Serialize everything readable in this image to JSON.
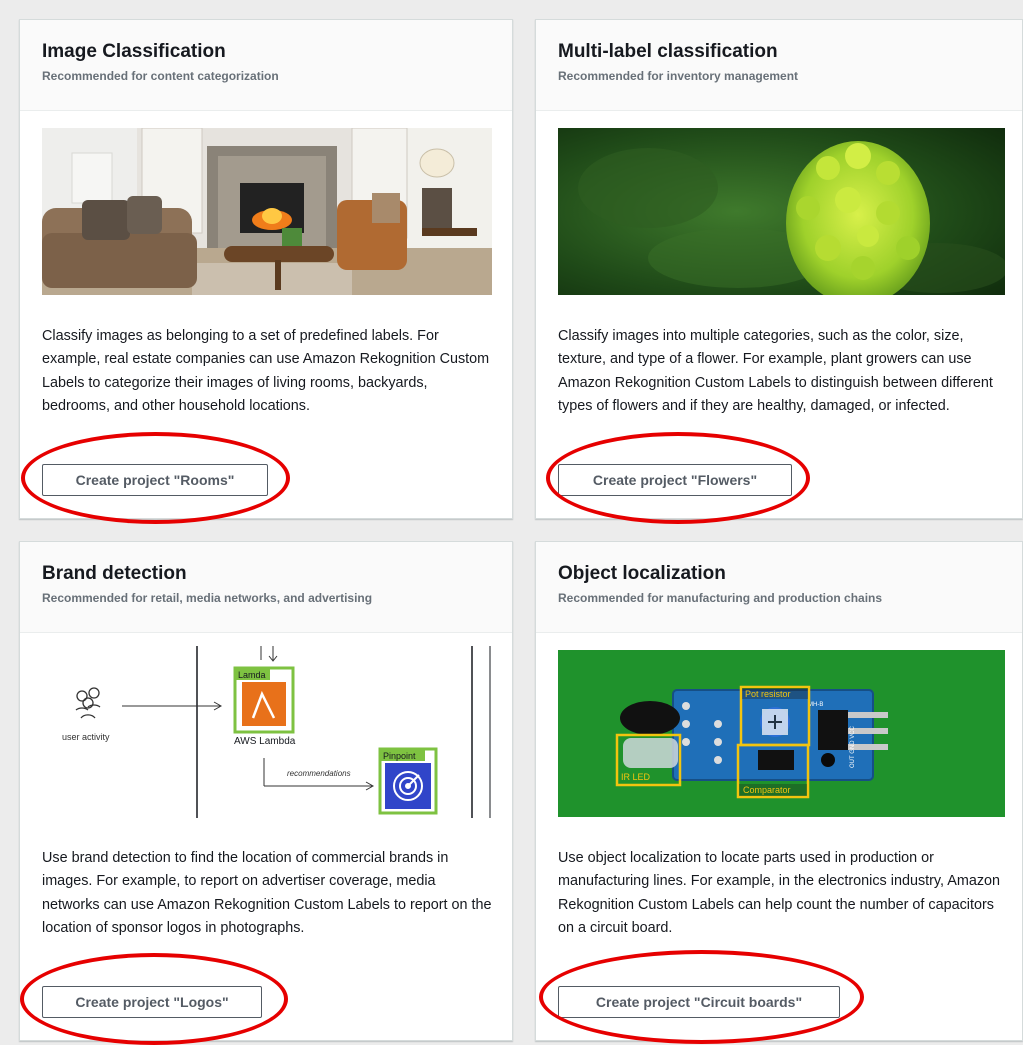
{
  "cards": [
    {
      "title": "Image Classification",
      "subtitle": "Recommended for content categorization",
      "description": "Classify images as belonging to a set of predefined labels. For example, real estate companies can use Amazon Rekognition Custom Labels to categorize their images of living rooms, backyards, bedrooms, and other household locations.",
      "button_label": "Create project \"Rooms\""
    },
    {
      "title": "Multi-label classification",
      "subtitle": "Recommended for inventory management",
      "description": "Classify images into multiple categories, such as the color, size, texture, and type of a flower. For example, plant growers can use Amazon Rekognition Custom Labels to distinguish between different types of flowers and if they are healthy, damaged, or infected.",
      "button_label": "Create project \"Flowers\""
    },
    {
      "title": "Brand detection",
      "subtitle": "Recommended for retail, media networks, and advertising",
      "description": "Use brand detection to find the location of commercial brands in images. For example, to report on advertiser coverage, media networks can use Amazon Rekognition Custom Labels to report on the location of sponsor logos in photographs.",
      "button_label": "Create project \"Logos\"",
      "diagram": {
        "user_label": "user activity",
        "lambda_tag": "Lamda",
        "lambda_label": "AWS Lambda",
        "arrow_label": "recommendations",
        "pinpoint_tag": "Pinpoint"
      }
    },
    {
      "title": "Object localization",
      "subtitle": "Recommended for manufacturing and production chains",
      "description": "Use object localization to locate parts used in production or manufacturing lines. For example, in the electronics industry, Amazon Rekognition Custom Labels can help count the number of capacitors on a circuit board.",
      "button_label": "Create project \"Circuit boards\"",
      "annotations": {
        "pot": "Pot resistor",
        "ir": "IR LED",
        "comparator": "Comparator",
        "board_marks": "OUT GND VCC",
        "board_id": "MH-B"
      }
    }
  ],
  "colors": {
    "annotation_ring": "#e60000",
    "bbox_yellow": "#f2c40f",
    "bbox_green": "#7ec241",
    "lambda_orange": "#e8711a",
    "pinpoint_blue": "#3045c9"
  }
}
